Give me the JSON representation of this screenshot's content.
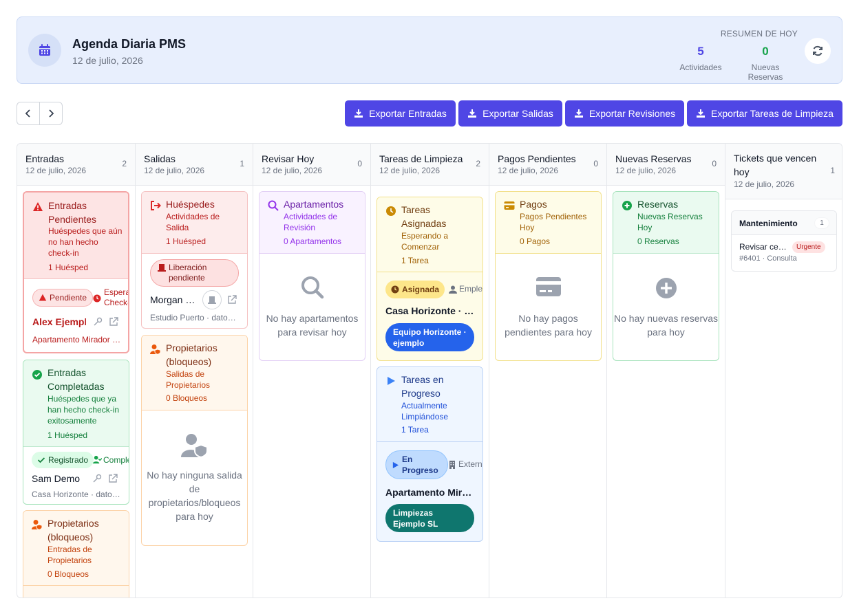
{
  "header": {
    "title": "Agenda Diaria PMS",
    "date": "12 de julio, 2026",
    "summary_label": "RESUMEN DE HOY",
    "stats": [
      {
        "value": "5",
        "label": "Actividades",
        "color": "#4f46e5"
      },
      {
        "value": "0",
        "label": "Nuevas Reservas",
        "color": "#16a34a"
      }
    ]
  },
  "toolbar": {
    "exports": [
      "Exportar Entradas",
      "Exportar Salidas",
      "Exportar Revisiones",
      "Exportar Tareas de Limpieza"
    ]
  },
  "columns": [
    {
      "title": "Entradas",
      "date": "12 de julio, 2026",
      "count": "2"
    },
    {
      "title": "Salidas",
      "date": "12 de julio, 2026",
      "count": "1"
    },
    {
      "title": "Revisar Hoy",
      "date": "12 de julio, 2026",
      "count": "0"
    },
    {
      "title": "Tareas de Limpieza",
      "date": "12 de julio, 2026",
      "count": "2"
    },
    {
      "title": "Pagos Pendientes",
      "date": "12 de julio, 2026",
      "count": "0"
    },
    {
      "title": "Nuevas Reservas",
      "date": "12 de julio, 2026",
      "count": "0"
    },
    {
      "title": "Tickets que vencen hoy",
      "date": "12 de julio, 2026",
      "count": "1"
    }
  ],
  "entradas": {
    "pending": {
      "title": "Entradas Pendientes",
      "subtitle": "Huéspedes que aún no han hecho check-in",
      "count": "1 Huésped",
      "badge": "Pendiente",
      "extra": "Esperando Check-in",
      "guest": "Alex Ejemplo",
      "apartment": "Apartamento Mirador Ejemplo"
    },
    "done": {
      "title": "Entradas Completadas",
      "subtitle": "Huéspedes que ya han hecho check-in exitosamente",
      "count": "1 Huésped",
      "badge": "Registrado",
      "extra": "Completado",
      "guest": "Sam Demo",
      "apartment": "Casa Horizonte · datos de ejemplo"
    },
    "owners": {
      "title": "Propietarios (bloqueos)",
      "subtitle": "Entradas de Propietarios",
      "count": "0 Bloqueos"
    }
  },
  "salidas": {
    "guests": {
      "title": "Huéspedes",
      "subtitle": "Actividades de Salida",
      "count": "1 Huésped",
      "badge": "Liberación pendiente",
      "guest": "Morgan Ejemplo",
      "apartment": "Estudio Puerto · datos de ejemplo"
    },
    "owners": {
      "title": "Propietarios (bloqueos)",
      "subtitle": "Salidas de Propietarios",
      "count": "0 Bloqueos",
      "empty": "No hay ninguna salida de propietarios/bloqueos para hoy"
    }
  },
  "revisar": {
    "title": "Apartamentos",
    "subtitle": "Actividades de Revisión",
    "count": "0 Apartamentos",
    "empty": "No hay apartamentos para revisar hoy"
  },
  "limpieza": {
    "assigned": {
      "title": "Tareas Asignadas",
      "subtitle": "Esperando a Comenzar",
      "count": "1 Tarea",
      "badge": "Asignada",
      "staff": "Empleado",
      "apartment": "Casa Horizonte · Ejemplo",
      "team": "Equipo Horizonte · ejemplo",
      "team_color": "#2563eb"
    },
    "progress": {
      "title": "Tareas en Progreso",
      "subtitle": "Actualmente Limpiándose",
      "count": "1 Tarea",
      "badge": "En Progreso",
      "staff": "Externo",
      "apartment": "Apartamento Mirador Ejemplo",
      "team": "Limpiezas Ejemplo SL",
      "team_color": "#0f766e"
    }
  },
  "pagos": {
    "title": "Pagos",
    "subtitle": "Pagos Pendientes Hoy",
    "count": "0 Pagos",
    "empty": "No hay pagos pendientes para hoy"
  },
  "reservas": {
    "title": "Reservas",
    "subtitle": "Nuevas Reservas Hoy",
    "count": "0 Reservas",
    "empty": "No hay nuevas reservas para hoy"
  },
  "tickets": {
    "group": "Mantenimiento",
    "count": "1",
    "item": "Revisar cerradura",
    "priority": "Urgente",
    "meta": "#6401 · Consulta"
  },
  "colors": {
    "accent": "#4f46e5",
    "red": "#b91c1c",
    "green": "#15803d",
    "orange": "#c2410c",
    "purple": "#7e22ce",
    "yellow": "#a16207",
    "blue": "#1d4ed8"
  }
}
